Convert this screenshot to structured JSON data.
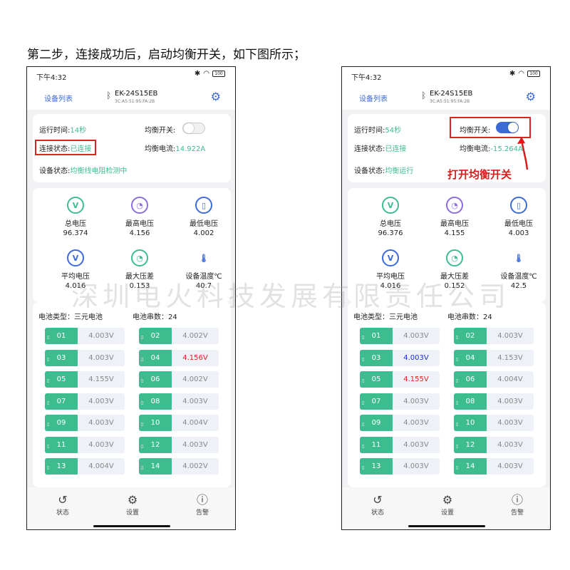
{
  "caption": "第二步，连接成功后，启动均衡开关，如下图所示；",
  "annotation": "打开均衡开关",
  "watermark": "深圳电火科技发展有限责任公司",
  "colors": {
    "accent": "#3c6bd8",
    "green": "#3dbd8f",
    "red": "#e12222",
    "voltage_high_blue": "#1a2fd0"
  },
  "phones": [
    {
      "status_time": "下午4:32",
      "battery": "100",
      "nav": {
        "device_list": "设备列表",
        "device_name": "EK-24S15EB",
        "mac": "3C:A5:51:95:FA:2B"
      },
      "info": {
        "runtime_label": "运行时间:",
        "runtime_value": "14秒",
        "balance_label": "均衡开关:",
        "balance_on": false,
        "conn_label": "连接状态:",
        "conn_value": "已连接",
        "current_label": "均衡电流:",
        "current_value": "14.922A",
        "device_label": "设备状态:",
        "device_value": "均衡线电阻检测中"
      },
      "stats": [
        {
          "name": "总电压",
          "value": "96.374",
          "icon": "total-voltage-icon"
        },
        {
          "name": "最高电压",
          "value": "4.156",
          "icon": "max-voltage-gauge-icon"
        },
        {
          "name": "最低电压",
          "value": "4.002",
          "icon": "min-voltage-battery-icon"
        },
        {
          "name": "平均电压",
          "value": "4.016",
          "icon": "avg-voltage-icon"
        },
        {
          "name": "最大压差",
          "value": "0.153",
          "icon": "max-diff-gauge-icon"
        },
        {
          "name": "设备温度℃",
          "value": "40.7",
          "icon": "thermometer-icon"
        }
      ],
      "battery_type": "电池类型：三元电池",
      "cell_count": "电池串数：24",
      "cells": [
        {
          "idx": "01",
          "v": "4.003V",
          "mark": ""
        },
        {
          "idx": "02",
          "v": "4.002V",
          "mark": ""
        },
        {
          "idx": "03",
          "v": "4.003V",
          "mark": ""
        },
        {
          "idx": "04",
          "v": "4.156V",
          "mark": "red"
        },
        {
          "idx": "05",
          "v": "4.155V",
          "mark": ""
        },
        {
          "idx": "06",
          "v": "4.002V",
          "mark": ""
        },
        {
          "idx": "07",
          "v": "4.003V",
          "mark": ""
        },
        {
          "idx": "08",
          "v": "4.003V",
          "mark": ""
        },
        {
          "idx": "09",
          "v": "4.003V",
          "mark": ""
        },
        {
          "idx": "10",
          "v": "4.004V",
          "mark": ""
        },
        {
          "idx": "11",
          "v": "4.003V",
          "mark": ""
        },
        {
          "idx": "12",
          "v": "4.003V",
          "mark": ""
        },
        {
          "idx": "13",
          "v": "4.004V",
          "mark": ""
        },
        {
          "idx": "14",
          "v": "4.002V",
          "mark": ""
        }
      ],
      "tabs": [
        "状态",
        "设置",
        "告警"
      ]
    },
    {
      "status_time": "下午4:32",
      "battery": "100",
      "nav": {
        "device_list": "设备列表",
        "device_name": "EK-24S15EB",
        "mac": "3C:A5:51:95:FA:2B"
      },
      "info": {
        "runtime_label": "运行时间:",
        "runtime_value": "54秒",
        "balance_label": "均衡开关:",
        "balance_on": true,
        "conn_label": "连接状态:",
        "conn_value": "已连接",
        "current_label": "均衡电流:",
        "current_value": "-15.264A",
        "device_label": "设备状态:",
        "device_value": "均衡运行"
      },
      "stats": [
        {
          "name": "总电压",
          "value": "96.376",
          "icon": "total-voltage-icon"
        },
        {
          "name": "最高电压",
          "value": "4.155",
          "icon": "max-voltage-gauge-icon"
        },
        {
          "name": "最低电压",
          "value": "4.003",
          "icon": "min-voltage-battery-icon"
        },
        {
          "name": "平均电压",
          "value": "4.016",
          "icon": "avg-voltage-icon"
        },
        {
          "name": "最大压差",
          "value": "0.152",
          "icon": "max-diff-gauge-icon"
        },
        {
          "name": "设备温度℃",
          "value": "42.5",
          "icon": "thermometer-icon"
        }
      ],
      "battery_type": "电池类型：三元电池",
      "cell_count": "电池串数：24",
      "cells": [
        {
          "idx": "01",
          "v": "4.003V",
          "mark": ""
        },
        {
          "idx": "02",
          "v": "4.003V",
          "mark": ""
        },
        {
          "idx": "03",
          "v": "4.003V",
          "mark": "blue"
        },
        {
          "idx": "04",
          "v": "4.153V",
          "mark": ""
        },
        {
          "idx": "05",
          "v": "4.155V",
          "mark": "red"
        },
        {
          "idx": "06",
          "v": "4.004V",
          "mark": ""
        },
        {
          "idx": "07",
          "v": "4.003V",
          "mark": ""
        },
        {
          "idx": "08",
          "v": "4.003V",
          "mark": ""
        },
        {
          "idx": "09",
          "v": "4.003V",
          "mark": ""
        },
        {
          "idx": "10",
          "v": "4.003V",
          "mark": ""
        },
        {
          "idx": "11",
          "v": "4.003V",
          "mark": ""
        },
        {
          "idx": "12",
          "v": "4.003V",
          "mark": ""
        },
        {
          "idx": "13",
          "v": "4.003V",
          "mark": ""
        },
        {
          "idx": "14",
          "v": "4.003V",
          "mark": ""
        }
      ],
      "tabs": [
        "状态",
        "设置",
        "告警"
      ]
    }
  ]
}
